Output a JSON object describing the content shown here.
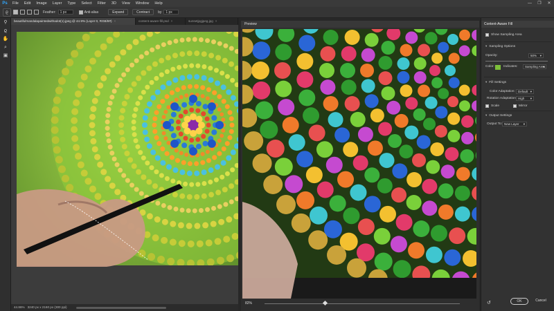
{
  "app": {
    "logo": "Ps"
  },
  "menu": [
    "File",
    "Edit",
    "Image",
    "Layer",
    "Type",
    "Select",
    "Filter",
    "3D",
    "View",
    "Window",
    "Help"
  ],
  "window_controls": [
    "—",
    "❐",
    "✕"
  ],
  "options": {
    "feather_label": "Feather:",
    "feather_value": "1 px",
    "antialias_label": "Anti-alias",
    "expand_label": "Expand",
    "contract_label": "Contract",
    "by_label": "by",
    "by_value": "1 px"
  },
  "tabs": [
    {
      "label": "beautifulmandalapaintedwithadot(1).jpeg @ 44.9% (Layer 0, RGB/8#)",
      "active": true
    },
    {
      "label": "content-aware-fill.psd",
      "active": false
    },
    {
      "label": "sunsetjpgjpeg.jpg",
      "active": false
    }
  ],
  "status": {
    "zoom": "44.86%",
    "doc": "3240 px x 2160 px (300 ppi)"
  },
  "preview": {
    "title": "Preview",
    "zoom": "82%",
    "zoom_fraction": 0.3
  },
  "panel": {
    "title": "Content-Aware Fill",
    "show_sampling": "Show Sampling Area",
    "sampling_options": "Sampling Options",
    "opacity_label": "Opacity:",
    "opacity_value": "50%",
    "color_label": "Color:",
    "indicates_label": "Indicates:",
    "indicates_value": "Sampling Area",
    "fill_settings": "Fill Settings",
    "color_adaptation_label": "Color Adaptation:",
    "color_adaptation_value": "Default",
    "rotation_adaptation_label": "Rotation Adaptation:",
    "rotation_adaptation_value": "High",
    "scale_label": "Scale",
    "mirror_label": "Mirror",
    "output_settings": "Output Settings",
    "output_to_label": "Output To:",
    "output_to_value": "New Layer",
    "ok": "OK",
    "cancel": "Cancel",
    "sampling_color": "#7dbf3a"
  }
}
